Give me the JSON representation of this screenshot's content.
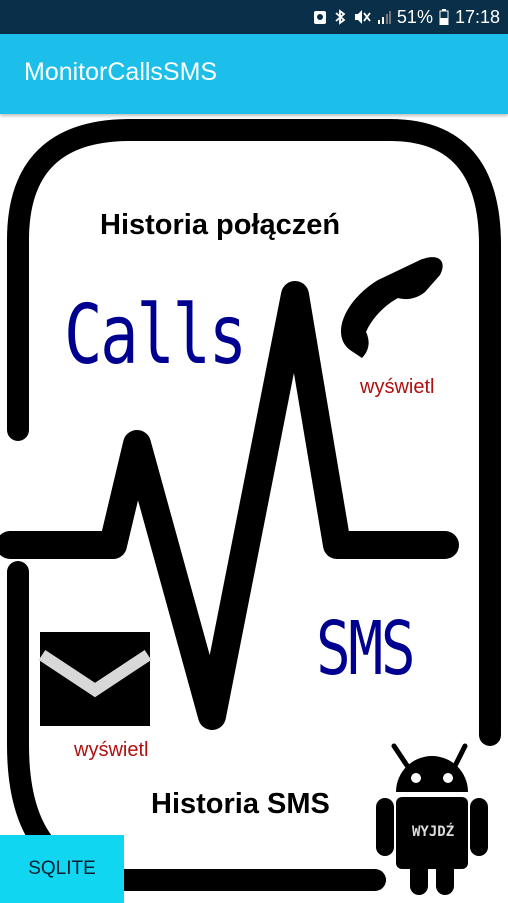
{
  "statusbar": {
    "battery": "51%",
    "time": "17:18"
  },
  "appbar": {
    "title": "MonitorCallsSMS"
  },
  "main": {
    "calls_heading": "Historia połączeń",
    "calls_word": "Calls",
    "calls_show": "wyświetl",
    "sms_word": "SMS",
    "sms_show": "wyświetl",
    "sms_heading": "Historia SMS",
    "exit_label": "WYJDŹ"
  },
  "buttons": {
    "sqlite": "SQLITE"
  },
  "colors": {
    "appbar": "#1bbfe9",
    "statusbar": "#0a2f48",
    "button": "#10d6f2",
    "big_words": "#000090",
    "link": "#b01010"
  }
}
